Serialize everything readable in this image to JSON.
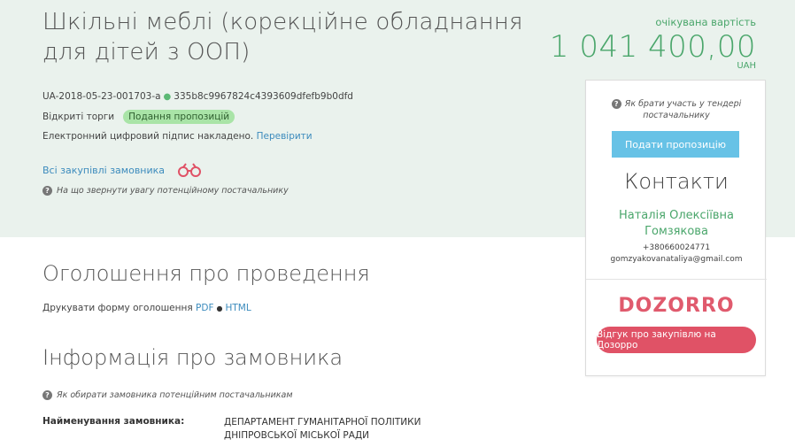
{
  "tender": {
    "title": "Шкільні меблі (корекційне обладнання для дітей з ООП)",
    "expected_label": "очікувана вартість",
    "expected_value": "1 041 400,00",
    "currency": "UAH",
    "id": "UA-2018-05-23-001703-a",
    "hash": "335b8c9967824c4393609dfefb9b0dfd",
    "procedure": "Відкриті торги",
    "status": "Подання пропозицій",
    "signature_text": "Електронний цифровий підпис накладено.",
    "signature_link": "Перевірити",
    "all_purchases_link": "Всі закупівлі замовника",
    "attention_hint": "На що звернути увагу потенційному постачальнику"
  },
  "announcement": {
    "heading": "Оголошення про проведення",
    "print_label": "Друкувати форму оголошення",
    "pdf": "PDF",
    "html": "HTML"
  },
  "customer": {
    "heading": "Інформація про замовника",
    "hint": "Як обирати замовника потенційним постачальникам",
    "name_label": "Найменування замовника:",
    "name_value": "ДЕПАРТАМЕНТ ГУМАНІТАРНОЇ ПОЛІТИКИ ДНІПРОВСЬКОЇ МІСЬКОЇ РАДИ"
  },
  "panel": {
    "hint": "Як брати участь у тендері постачальнику",
    "submit_label": "Подати пропозицію",
    "contacts_title": "Контакти",
    "contact_name": "Наталія Олексіївна Гомзякова",
    "contact_phone": "+380660024771",
    "contact_email": "gomzyakovanataliya@gmail.com",
    "dozorro_logo": "DOZORRO",
    "dozorro_button": "Відгук про закупівлю на Дозорро"
  },
  "colors": {
    "accent_green": "#4aa66b",
    "band_bg": "#eaf2ed",
    "link_blue": "#3c8bbd",
    "submit_blue": "#67c2e6",
    "dozorro_red": "#e05266"
  },
  "icons": [
    "question-icon",
    "binoculars-icon"
  ]
}
